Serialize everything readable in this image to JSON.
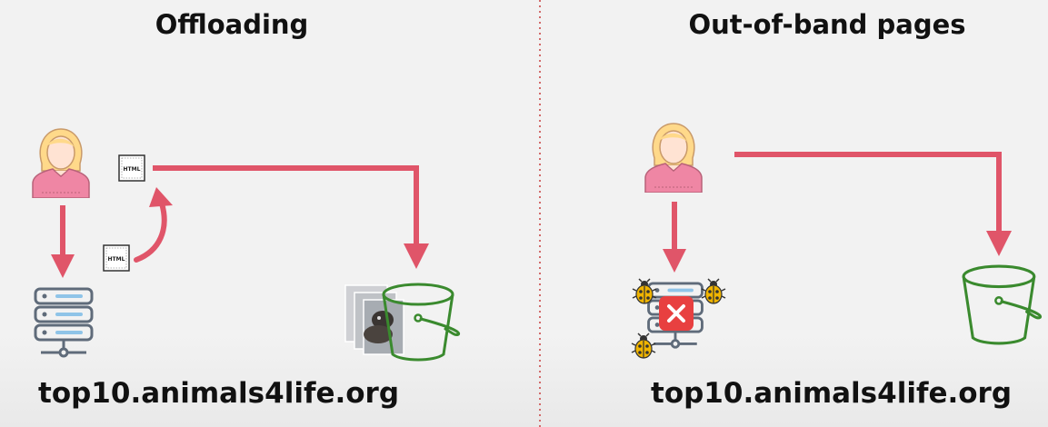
{
  "left_panel": {
    "title": "Offloading",
    "domain": "top10.animals4life.org",
    "html_doc_top_label": "HTML",
    "html_doc_bottom_label": "HTML"
  },
  "right_panel": {
    "title": "Out-of-band pages",
    "domain": "top10.animals4life.org"
  },
  "colors": {
    "arrow": "#e05569",
    "bucket": "#3a8a2e",
    "divider": "#d26a6a",
    "user_skin": "#ffe3d3",
    "user_hair": "#ffd98a",
    "user_shirt": "#ef86a4",
    "server": "#5f6b7a",
    "error": "#e84040"
  },
  "icons": [
    "user-icon",
    "html-document-icon",
    "server-icon",
    "bucket-icon",
    "bug-icon",
    "error-icon",
    "animal-photos"
  ]
}
